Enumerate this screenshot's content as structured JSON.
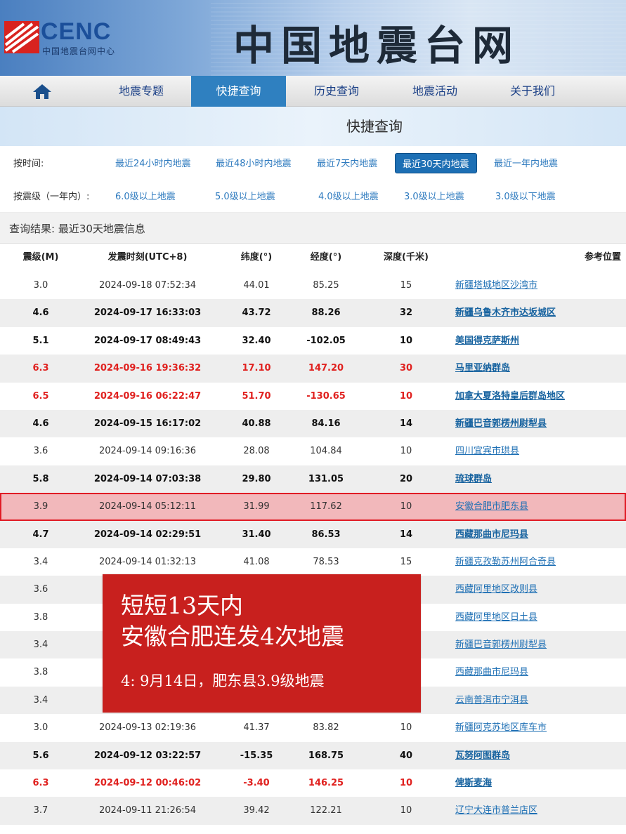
{
  "site": {
    "logo_text": "CENC",
    "logo_sub": "中国地震台网中心",
    "title": "中国地震台网"
  },
  "nav": {
    "items": [
      {
        "label": "地震专题",
        "active": false
      },
      {
        "label": "快捷查询",
        "active": true
      },
      {
        "label": "历史查询",
        "active": false
      },
      {
        "label": "地震活动",
        "active": false
      },
      {
        "label": "关于我们",
        "active": false
      }
    ],
    "home_icon": "home-icon"
  },
  "section_title": "快捷查询",
  "filters": {
    "time_label": "按时间:",
    "time_links": [
      "最近24小时内地震",
      "最近48小时内地震",
      "最近7天内地震",
      "最近30天内地震",
      "最近一年内地震"
    ],
    "time_active": 3,
    "mag_label": "按震级（一年内）:",
    "mag_links": [
      "6.0级以上地震",
      "5.0级以上地震",
      "4.0级以上地震",
      "3.0级以上地震",
      "3.0级以下地震"
    ]
  },
  "result_text": "查询结果: 最近30天地震信息",
  "table": {
    "headers": [
      "震级(M)",
      "发震时刻(UTC+8)",
      "纬度(°)",
      "经度(°)",
      "深度(千米)",
      "参考位置"
    ],
    "rows": [
      {
        "mag": "3.0",
        "time": "2024-09-18 07:52:34",
        "lat": "44.01",
        "lon": "85.25",
        "depth": "15",
        "loc": "新疆塔城地区沙湾市",
        "style": "normal"
      },
      {
        "mag": "4.6",
        "time": "2024-09-17 16:33:03",
        "lat": "43.72",
        "lon": "88.26",
        "depth": "32",
        "loc": "新疆乌鲁木齐市达坂城区",
        "style": "bold"
      },
      {
        "mag": "5.1",
        "time": "2024-09-17 08:49:43",
        "lat": "32.40",
        "lon": "-102.05",
        "depth": "10",
        "loc": "美国得克萨斯州",
        "style": "bold"
      },
      {
        "mag": "6.3",
        "time": "2024-09-16 19:36:32",
        "lat": "17.10",
        "lon": "147.20",
        "depth": "30",
        "loc": "马里亚纳群岛",
        "style": "red"
      },
      {
        "mag": "6.5",
        "time": "2024-09-16 06:22:47",
        "lat": "51.70",
        "lon": "-130.65",
        "depth": "10",
        "loc": "加拿大夏洛特皇后群岛地区",
        "style": "red"
      },
      {
        "mag": "4.6",
        "time": "2024-09-15 16:17:02",
        "lat": "40.88",
        "lon": "84.16",
        "depth": "14",
        "loc": "新疆巴音郭楞州尉犁县",
        "style": "bold"
      },
      {
        "mag": "3.6",
        "time": "2024-09-14 09:16:36",
        "lat": "28.08",
        "lon": "104.84",
        "depth": "10",
        "loc": "四川宜宾市珙县",
        "style": "normal"
      },
      {
        "mag": "5.8",
        "time": "2024-09-14 07:03:38",
        "lat": "29.80",
        "lon": "131.05",
        "depth": "20",
        "loc": "琉球群岛",
        "style": "bold"
      },
      {
        "mag": "3.9",
        "time": "2024-09-14 05:12:11",
        "lat": "31.99",
        "lon": "117.62",
        "depth": "10",
        "loc": "安徽合肥市肥东县",
        "style": "highlight"
      },
      {
        "mag": "4.7",
        "time": "2024-09-14 02:29:51",
        "lat": "31.40",
        "lon": "86.53",
        "depth": "14",
        "loc": "西藏那曲市尼玛县",
        "style": "bold"
      },
      {
        "mag": "3.4",
        "time": "2024-09-14 01:32:13",
        "lat": "41.08",
        "lon": "78.53",
        "depth": "15",
        "loc": "新疆克孜勒苏州阿合奇县",
        "style": "normal"
      },
      {
        "mag": "3.6",
        "time": "",
        "lat": "",
        "lon": "",
        "depth": "",
        "loc": "西藏阿里地区改则县",
        "style": "normal"
      },
      {
        "mag": "3.8",
        "time": "",
        "lat": "",
        "lon": "",
        "depth": "",
        "loc": "西藏阿里地区日土县",
        "style": "normal"
      },
      {
        "mag": "3.4",
        "time": "",
        "lat": "",
        "lon": "",
        "depth": "",
        "loc": "新疆巴音郭楞州尉犁县",
        "style": "normal"
      },
      {
        "mag": "3.8",
        "time": "",
        "lat": "",
        "lon": "",
        "depth": "",
        "loc": "西藏那曲市尼玛县",
        "style": "normal"
      },
      {
        "mag": "3.4",
        "time": "",
        "lat": "",
        "lon": "",
        "depth": "",
        "loc": "云南普洱市宁洱县",
        "style": "normal"
      },
      {
        "mag": "3.0",
        "time": "2024-09-13 02:19:36",
        "lat": "41.37",
        "lon": "83.82",
        "depth": "10",
        "loc": "新疆阿克苏地区库车市",
        "style": "normal"
      },
      {
        "mag": "5.6",
        "time": "2024-09-12 03:22:57",
        "lat": "-15.35",
        "lon": "168.75",
        "depth": "40",
        "loc": "瓦努阿图群岛",
        "style": "bold"
      },
      {
        "mag": "6.3",
        "time": "2024-09-12 00:46:02",
        "lat": "-3.40",
        "lon": "146.25",
        "depth": "10",
        "loc": "俾斯麦海",
        "style": "red"
      },
      {
        "mag": "3.7",
        "time": "2024-09-11 21:26:54",
        "lat": "39.42",
        "lon": "122.21",
        "depth": "10",
        "loc": "辽宁大连市普兰店区",
        "style": "normal"
      }
    ]
  },
  "overlay": {
    "line1": "短短13天内",
    "line2": "安徽合肥连发4次地震",
    "line3": "4:  9月14日，肥东县3.9级地震"
  },
  "colors": {
    "nav_active": "#2f80c0",
    "link": "#1d6fb4",
    "red_row": "#e0211f",
    "highlight_bg": "#f2b8bb",
    "highlight_border": "#e01b24",
    "overlay_bg": "#c8201e"
  }
}
